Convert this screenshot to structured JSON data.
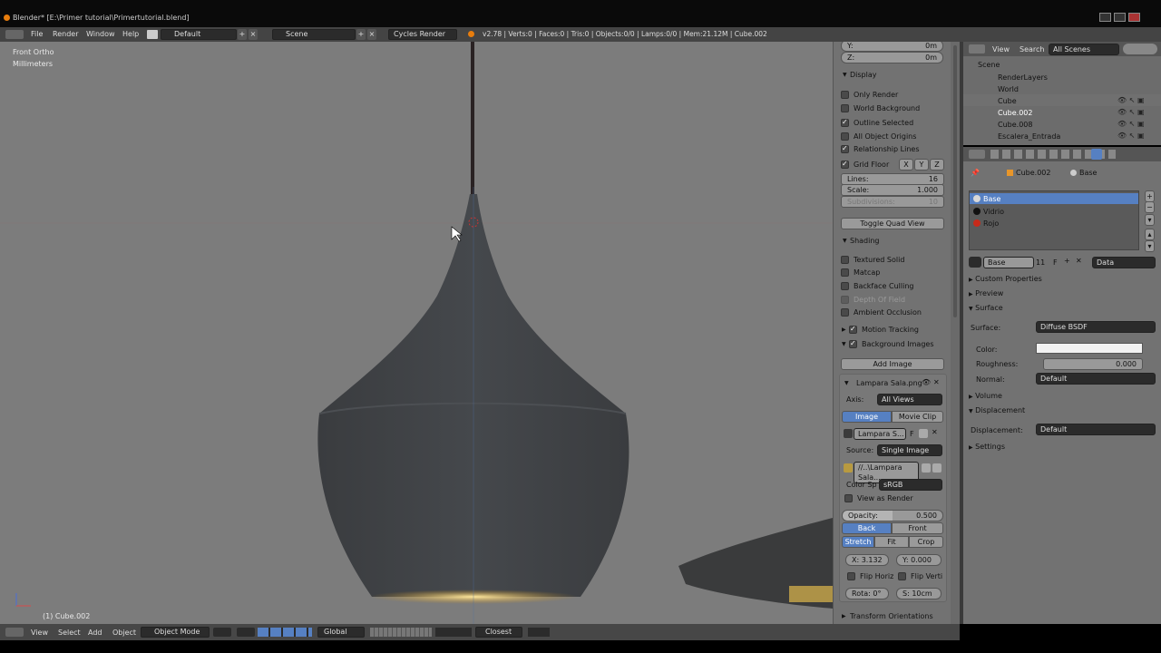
{
  "window": {
    "title": "Blender* [E:\\Primer tutorial\\Primertutorial.blend]"
  },
  "infobar": {
    "menus": [
      "File",
      "Render",
      "Window",
      "Help"
    ],
    "screen_layout": "Default",
    "scene": "Scene",
    "engine": "Cycles Render",
    "stats": "v2.78 | Verts:0 | Faces:0 | Tris:0 | Objects:0/0 | Lamps:0/0 | Mem:21.12M | Cube.002"
  },
  "viewport": {
    "view_name": "Front Ortho",
    "units": "Millimeters",
    "active_object": "(1) Cube.002"
  },
  "npanel": {
    "y_label": "Y:",
    "y_value": "0m",
    "z_label": "Z:",
    "z_value": "0m",
    "display": {
      "header": "Display",
      "only_render": "Only Render",
      "world_background": "World Background",
      "outline_selected": "Outline Selected",
      "all_object_origins": "All Object Origins",
      "relationship_lines": "Relationship Lines",
      "grid_floor": "Grid Floor",
      "axis_x": "X",
      "axis_y": "Y",
      "axis_z": "Z",
      "lines_label": "Lines:",
      "lines_value": "16",
      "scale_label": "Scale:",
      "scale_value": "1.000",
      "subdivisions_label": "Subdivisions:",
      "subdivisions_value": "10",
      "toggle_quad": "Toggle Quad View"
    },
    "shading": {
      "header": "Shading",
      "textured_solid": "Textured Solid",
      "matcap": "Matcap",
      "backface_culling": "Backface Culling",
      "depth_of_field": "Depth Of Field",
      "ambient_occlusion": "Ambient Occlusion"
    },
    "motion_tracking": "Motion Tracking",
    "background_images": "Background Images",
    "add_image": "Add Image",
    "bg_image": {
      "name": "Lampara Sala.png",
      "axis_label": "Axis:",
      "axis_value": "All Views",
      "tab_image": "Image",
      "tab_movie_clip": "Movie Clip",
      "image_name": "Lampara S...",
      "image_users": "F",
      "source_label": "Source:",
      "source_value": "Single Image",
      "path": "//..\\Lampara Sala...",
      "color_space_label": "Color Sp",
      "color_space_value": "sRGB",
      "view_as_render": "View as Render",
      "opacity_label": "Opacity:",
      "opacity_value": "0.500",
      "back": "Back",
      "front": "Front",
      "stretch": "Stretch",
      "fit": "Fit",
      "crop": "Crop",
      "x": "X: 3.132",
      "y": "Y: 0.000",
      "flip_horiz": "Flip Horiz",
      "flip_vert": "Flip Verti",
      "rotation": "Rota: 0°",
      "size": "S: 10cm"
    },
    "transform_orientations": "Transform Orientations"
  },
  "outliner": {
    "view": "View",
    "search": "Search",
    "filter": "All Scenes",
    "items": [
      "Scene",
      "RenderLayers",
      "World",
      "Cube",
      "Cube.002",
      "Cube.008",
      "Escalera_Entrada"
    ]
  },
  "properties": {
    "breadcrumb_object": "Cube.002",
    "breadcrumb_material": "Base",
    "materials": [
      {
        "name": "Base",
        "color": "#d8d8d8"
      },
      {
        "name": "Vidrio",
        "color": "#111111"
      },
      {
        "name": "Rojo",
        "color": "#c62a1a"
      }
    ],
    "material_name": "Base",
    "material_users": "11",
    "material_fake": "F",
    "link": "Data",
    "sections": {
      "custom_properties": "Custom Properties",
      "preview": "Preview",
      "surface": "Surface",
      "volume": "Volume",
      "displacement": "Displacement",
      "settings": "Settings"
    },
    "surface_label": "Surface:",
    "surface_value": "Diffuse BSDF",
    "color_label": "Color:",
    "roughness_label": "Roughness:",
    "roughness_value": "0.000",
    "normal_label": "Normal:",
    "normal_value": "Default",
    "displacement_label": "Displacement:",
    "displacement_value": "Default"
  },
  "bottombar": {
    "menus": [
      "View",
      "Select",
      "Add",
      "Object"
    ],
    "mode": "Object Mode",
    "orientation": "Global",
    "snap": "Closest"
  }
}
